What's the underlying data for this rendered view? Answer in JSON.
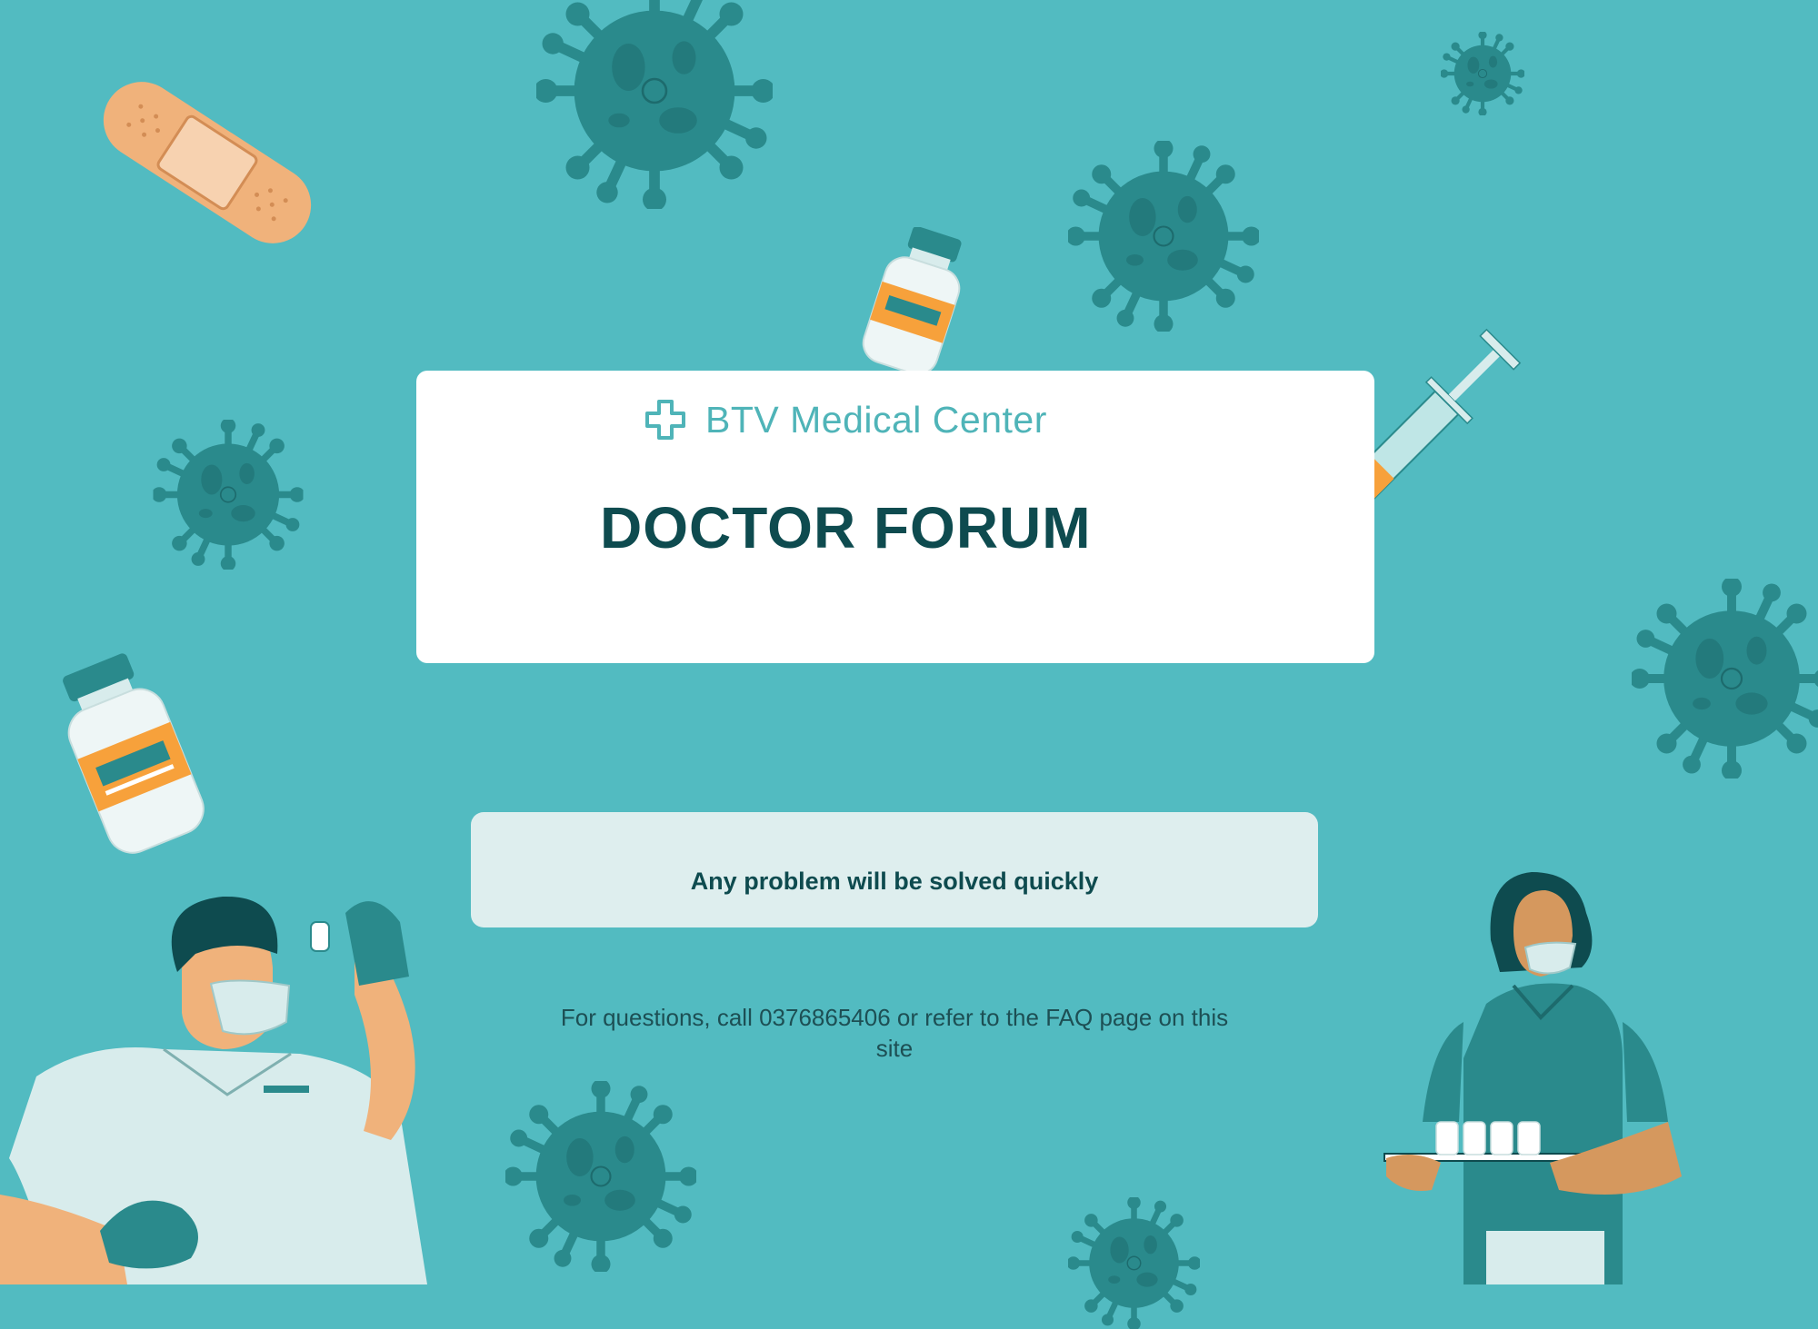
{
  "header": {
    "brand_name": "BTV Medical Center",
    "brand_icon": "medical-cross-icon",
    "title": "DOCTOR FORUM"
  },
  "banner": {
    "text": "Any problem will be solved quickly"
  },
  "contact": {
    "text": "For questions, call 0376865406 or refer to the FAQ page on this site"
  },
  "colors": {
    "background": "#52bbc1",
    "card": "#ffffff",
    "title": "#0e4b4f",
    "brand": "#4fb4b8",
    "banner": "#deeeee",
    "virus": "#2a8a8c",
    "accent_orange": "#f7a13b"
  },
  "decorations": [
    "virus-icon",
    "bandage-icon",
    "vaccine-vial-icon",
    "syringe-icon",
    "doctor-illustration",
    "nurse-illustration"
  ]
}
